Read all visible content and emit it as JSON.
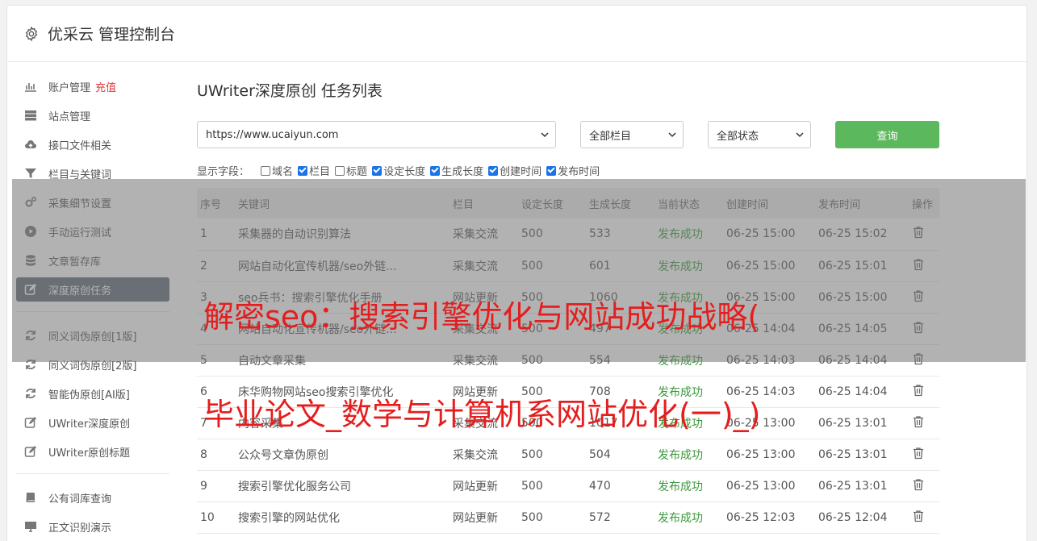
{
  "header": {
    "title": "优采云 管理控制台",
    "icon": "gear-icon"
  },
  "sidebar": {
    "group1": [
      {
        "label": "账户管理",
        "extra": "充值",
        "icon": "bar-chart-icon"
      },
      {
        "label": "站点管理",
        "icon": "server-icon"
      },
      {
        "label": "接口文件相关",
        "icon": "cloud-upload-icon"
      },
      {
        "label": "栏目与关键词",
        "icon": "filter-icon"
      },
      {
        "label": "采集细节设置",
        "icon": "gears-icon"
      },
      {
        "label": "手动运行测试",
        "icon": "play-circle-icon"
      },
      {
        "label": "文章暂存库",
        "icon": "database-icon"
      },
      {
        "label": "深度原创任务",
        "icon": "edit-icon",
        "active": true
      }
    ],
    "group2": [
      {
        "label": "同义词伪原创[1版]",
        "icon": "refresh-icon"
      },
      {
        "label": "同义词伪原创[2版]",
        "icon": "refresh-icon"
      },
      {
        "label": "智能伪原创[AI版]",
        "icon": "refresh-icon"
      },
      {
        "label": "UWriter深度原创",
        "icon": "edit-icon"
      },
      {
        "label": "UWriter原创标题",
        "icon": "edit-icon"
      }
    ],
    "group3": [
      {
        "label": "公有词库查询",
        "icon": "book-icon"
      },
      {
        "label": "正文识别演示",
        "icon": "monitor-icon"
      }
    ]
  },
  "main": {
    "title": "UWriter深度原创 任务列表",
    "site_select": "https://www.ucaiyun.com",
    "column_select": "全部栏目",
    "status_select": "全部状态",
    "query_button": "查询",
    "fields_label": "显示字段：",
    "fields": [
      {
        "label": "域名",
        "checked": false
      },
      {
        "label": "栏目",
        "checked": true
      },
      {
        "label": "标题",
        "checked": false
      },
      {
        "label": "设定长度",
        "checked": true
      },
      {
        "label": "生成长度",
        "checked": true
      },
      {
        "label": "创建时间",
        "checked": true
      },
      {
        "label": "发布时间",
        "checked": true
      }
    ],
    "table": {
      "headers": [
        "序号",
        "关键词",
        "栏目",
        "设定长度",
        "生成长度",
        "当前状态",
        "创建时间",
        "发布时间",
        "操作"
      ],
      "rows": [
        [
          "1",
          "采集器的自动识别算法",
          "采集交流",
          "500",
          "533",
          "发布成功",
          "06-25 15:00",
          "06-25 15:02"
        ],
        [
          "2",
          "网站自动化宣传机器/seo外链...",
          "采集交流",
          "500",
          "601",
          "发布成功",
          "06-25 15:00",
          "06-25 15:01"
        ],
        [
          "3",
          "seo兵书：搜索引擎优化手册",
          "网站更新",
          "500",
          "1060",
          "发布成功",
          "06-25 15:00",
          "06-25 15:00"
        ],
        [
          "4",
          "网站自动化宣传机器/seo外链...",
          "采集交流",
          "500",
          "497",
          "发布成功",
          "06-25 14:04",
          "06-25 14:05"
        ],
        [
          "5",
          "自动文章采集",
          "采集交流",
          "500",
          "554",
          "发布成功",
          "06-25 14:03",
          "06-25 14:04"
        ],
        [
          "6",
          "床华购物网站seo搜索引擎优化",
          "网站更新",
          "500",
          "708",
          "发布成功",
          "06-25 14:03",
          "06-25 14:04"
        ],
        [
          "7",
          "内容采集",
          "采集交流",
          "500",
          "1017",
          "发布成功",
          "06-25 13:00",
          "06-25 13:01"
        ],
        [
          "8",
          "公众号文章伪原创",
          "采集交流",
          "500",
          "504",
          "发布成功",
          "06-25 13:00",
          "06-25 13:01"
        ],
        [
          "9",
          "搜索引擎优化服务公司",
          "网站更新",
          "500",
          "470",
          "发布成功",
          "06-25 13:00",
          "06-25 13:01"
        ],
        [
          "10",
          "搜索引擎的网站优化",
          "网站更新",
          "500",
          "572",
          "发布成功",
          "06-25 12:03",
          "06-25 12:04"
        ]
      ]
    }
  },
  "overlay": {
    "line1": "解密seo：搜索引擎优化与网站成功战略(",
    "line2": "毕业论文_数学与计算机系网站优化(一)_)"
  },
  "colors": {
    "accent_green": "#5cb85c",
    "active_nav": "#5f6b7a",
    "overlay_red": "#e41e1e",
    "status_green": "#3a9a3a"
  }
}
